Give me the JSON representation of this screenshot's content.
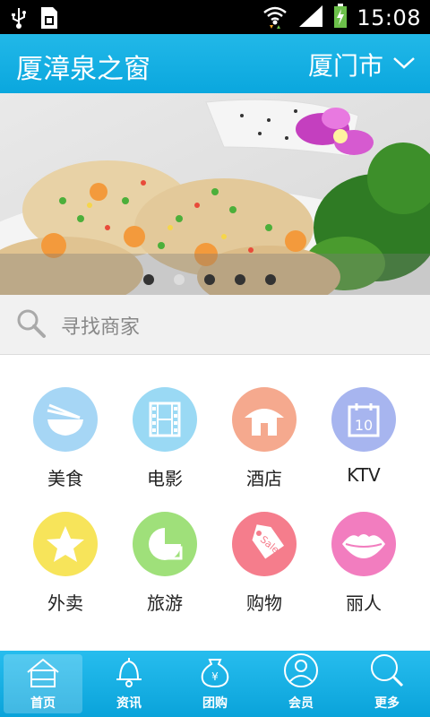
{
  "status_bar": {
    "time": "15:08",
    "icons": [
      "usb-icon",
      "sim-card-icon",
      "wifi-icon",
      "signal-icon",
      "battery-charging-icon"
    ]
  },
  "header": {
    "title": "厦漳泉之窗",
    "city": "厦门市",
    "dropdown_icon": "chevron-down-icon"
  },
  "banner": {
    "image": "seafood-scallop-dish",
    "slide_count": 5,
    "active_index": 1
  },
  "search": {
    "placeholder": "寻找商家",
    "icon": "search-icon"
  },
  "categories": [
    {
      "label": "美食",
      "icon": "bowl-chopsticks-icon",
      "color": "#a6d6f5"
    },
    {
      "label": "电影",
      "icon": "film-icon",
      "color": "#9ad9f4"
    },
    {
      "label": "酒店",
      "icon": "hut-icon",
      "color": "#f5a98e"
    },
    {
      "label": "KTV",
      "icon": "calendar-icon",
      "color": "#a7b5ef"
    },
    {
      "label": "外卖",
      "icon": "star-icon",
      "color": "#f7e45a"
    },
    {
      "label": "旅游",
      "icon": "map-icon",
      "color": "#9fe07a"
    },
    {
      "label": "购物",
      "icon": "sale-tag-icon",
      "color": "#f57d8c"
    },
    {
      "label": "丽人",
      "icon": "lips-icon",
      "color": "#f27dbf"
    }
  ],
  "bottom_nav": {
    "items": [
      {
        "label": "首页",
        "icon": "home-icon"
      },
      {
        "label": "资讯",
        "icon": "bell-icon"
      },
      {
        "label": "团购",
        "icon": "money-bag-icon"
      },
      {
        "label": "会员",
        "icon": "user-icon"
      },
      {
        "label": "更多",
        "icon": "search-icon"
      }
    ],
    "active": "首页"
  },
  "colors": {
    "accent": "#0aa7de",
    "status_bar": "#000000"
  }
}
